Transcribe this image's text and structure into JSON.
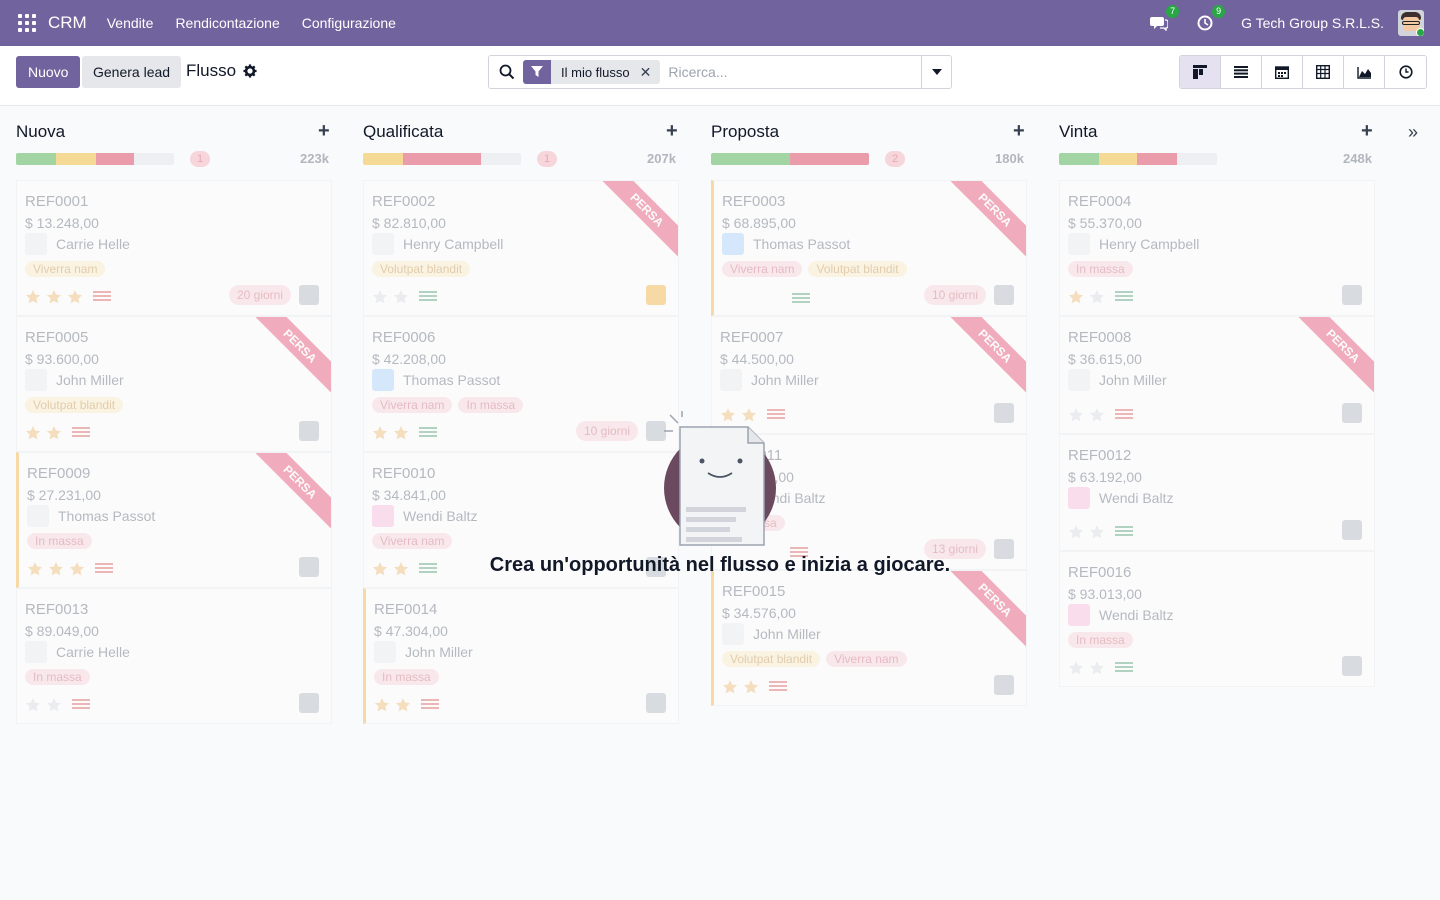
{
  "navbar": {
    "brand": "CRM",
    "menu": [
      "Vendite",
      "Rendicontazione",
      "Configurazione"
    ],
    "messages_count": "7",
    "activities_count": "9",
    "company": "G Tech Group S.R.L.S.",
    "accent": "#71639e"
  },
  "control": {
    "new_label": "Nuovo",
    "generate_label": "Genera lead",
    "breadcrumb": "Flusso",
    "facet_label": "Il mio flusso",
    "search_placeholder": "Ricerca..."
  },
  "views": [
    "kanban",
    "list",
    "calendar",
    "pivot",
    "graph",
    "activity"
  ],
  "columns": [
    {
      "title": "Nuova",
      "count": "1",
      "sum": "223k"
    },
    {
      "title": "Qualificata",
      "count": "1",
      "sum": "207k"
    },
    {
      "title": "Proposta",
      "count": "2",
      "sum": "180k"
    },
    {
      "title": "Vinta",
      "count": "",
      "sum": "248k"
    }
  ],
  "ribbon_label": "PERSA",
  "cards": [
    {
      "ref": "REF0001",
      "amount": "$ 13.248,00",
      "person": "Carrie Helle",
      "tags": [
        "Viverra nam"
      ],
      "days": "20 giorni"
    },
    {
      "ref": "REF0005",
      "amount": "$ 93.600,00",
      "person": "John Miller",
      "tags": [
        "Volutpat blandit"
      ]
    },
    {
      "ref": "REF0009",
      "amount": "$ 27.231,00",
      "person": "Thomas Passot",
      "tags": [
        "In massa"
      ]
    },
    {
      "ref": "REF0013",
      "amount": "$ 89.049,00",
      "person": "Carrie Helle",
      "tags": [
        "In massa"
      ]
    },
    {
      "ref": "REF0002",
      "amount": "$ 82.810,00",
      "person": "Henry Campbell",
      "tags": [
        "Volutpat blandit"
      ]
    },
    {
      "ref": "REF0006",
      "amount": "$ 42.208,00",
      "person": "Thomas Passot",
      "tags": [
        "Viverra nam",
        "In massa"
      ],
      "days": "10 giorni"
    },
    {
      "ref": "REF0010",
      "amount": "$ 34.841,00",
      "person": "Wendi Baltz",
      "tags": [
        "Viverra nam"
      ]
    },
    {
      "ref": "REF0014",
      "amount": "$ 47.304,00",
      "person": "John Miller",
      "tags": [
        "In massa"
      ]
    },
    {
      "ref": "REF0003",
      "amount": "$ 68.895,00",
      "person": "Thomas Passot",
      "tags": [
        "Viverra nam",
        "Volutpat blandit"
      ],
      "days": "10 giorni"
    },
    {
      "ref": "REF0007",
      "amount": "$ 44.500,00",
      "person": "John Miller",
      "tags": []
    },
    {
      "ref": "REF0011",
      "amount": "$ 17.400,00",
      "person": "Wendi Baltz",
      "tags": [
        "In massa"
      ],
      "days": "13 giorni"
    },
    {
      "ref": "REF0015",
      "amount": "$ 34.576,00",
      "person": "John Miller",
      "tags": [
        "Volutpat blandit",
        "Viverra nam"
      ]
    },
    {
      "ref": "REF0004",
      "amount": "$ 55.370,00",
      "person": "Henry Campbell",
      "tags": [
        "In massa"
      ]
    },
    {
      "ref": "REF0008",
      "amount": "$ 36.615,00",
      "person": "John Miller",
      "tags": []
    },
    {
      "ref": "REF0012",
      "amount": "$ 63.192,00",
      "person": "Wendi Baltz",
      "tags": []
    },
    {
      "ref": "REF0016",
      "amount": "$ 93.013,00",
      "person": "Wendi Baltz",
      "tags": [
        "In massa"
      ]
    }
  ],
  "empty_state": {
    "title": "Crea un'opportunità nel flusso e inizia a giocare."
  }
}
